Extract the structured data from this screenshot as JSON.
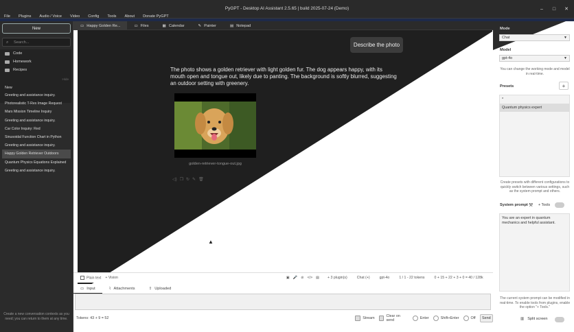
{
  "window": {
    "title": "PyGPT - Desktop AI Assistant 2.5.65 | build 2025-07-24 (Demo)"
  },
  "menu": [
    "File",
    "Plugins",
    "Audio / Voice",
    "Video",
    "Config",
    "Tools",
    "About",
    "Donate PyGPT"
  ],
  "left": {
    "new_label": "New",
    "search_placeholder": "Search...",
    "folders": [
      "Code",
      "Homework",
      "Recipes"
    ],
    "hide_label": "Hide",
    "conversations_header": "New",
    "conversations": [
      "Greeting and assistance inquiry.",
      "Photorealistic T-Rex Image Request",
      "Mars Mission Timeline Inquiry",
      "Greeting and assistance inquiry.",
      "Car Color Inquiry: Red",
      "Sinusoidal Function Chart in Python",
      "Greeting and assistance inquiry.",
      "Happy Golden Retriever Outdoors",
      "Quantum Physics Equations Explained",
      "Greeting and assistance inquiry."
    ],
    "selected_index": 7,
    "hint": "Create a new conversation contexts as you need; you can return to them at any time."
  },
  "tabs": [
    "Happy Golden Re...",
    "Files",
    "Calendar",
    "Painter",
    "Notepad"
  ],
  "chat": {
    "user_message": "Describe the photo",
    "answer": "The photo shows a golden retriever with light golden fur. The dog appears happy, with its mouth open and tongue out, likely due to panting. The background is softly blurred, suggesting an outdoor setting with greenery.",
    "image_label": "golden-retriever-tongue-out.jpg"
  },
  "status": {
    "plain_text": "Plain text",
    "vision": "+ Vision",
    "plugins": "+ 3 plugin(s)",
    "mode": "Chat (+)",
    "model": "gpt-4o",
    "ctx": "1 / 1 - 22 tokens",
    "tokens": "0 + 15 + 22 + 3 + 0 = 40 / 128k"
  },
  "input_tabs": [
    "Input",
    "Attachments",
    "Uploaded"
  ],
  "bottom": {
    "tokens": "Tokens: 43 + 9 = 52",
    "stream": "Stream",
    "clear": "Clear on send",
    "enter": "Enter",
    "shift_enter": "Shift+Enter",
    "off": "Off",
    "send": "Send"
  },
  "right": {
    "mode_label": "Mode",
    "mode_value": "Chat",
    "model_label": "Model",
    "model_value": "gpt-4o",
    "model_hint": "You can change the working mode and model in real-time.",
    "presets_label": "Presets",
    "presets": [
      "*",
      "Quantum physics expert"
    ],
    "presets_hint": "Create presets with different configurations to quickly switch between various settings, such as the system prompt and others.",
    "system_prompt_label": "System prompt",
    "tools_label": "+ Tools",
    "system_prompt": "You are an expert in quantum mechanics and helpful assistant.",
    "system_hint": "The current system prompt can be modified in real-time. To enable tools from plugins, enable the option \"+ Tools.\"",
    "split_label": "Split screen"
  }
}
